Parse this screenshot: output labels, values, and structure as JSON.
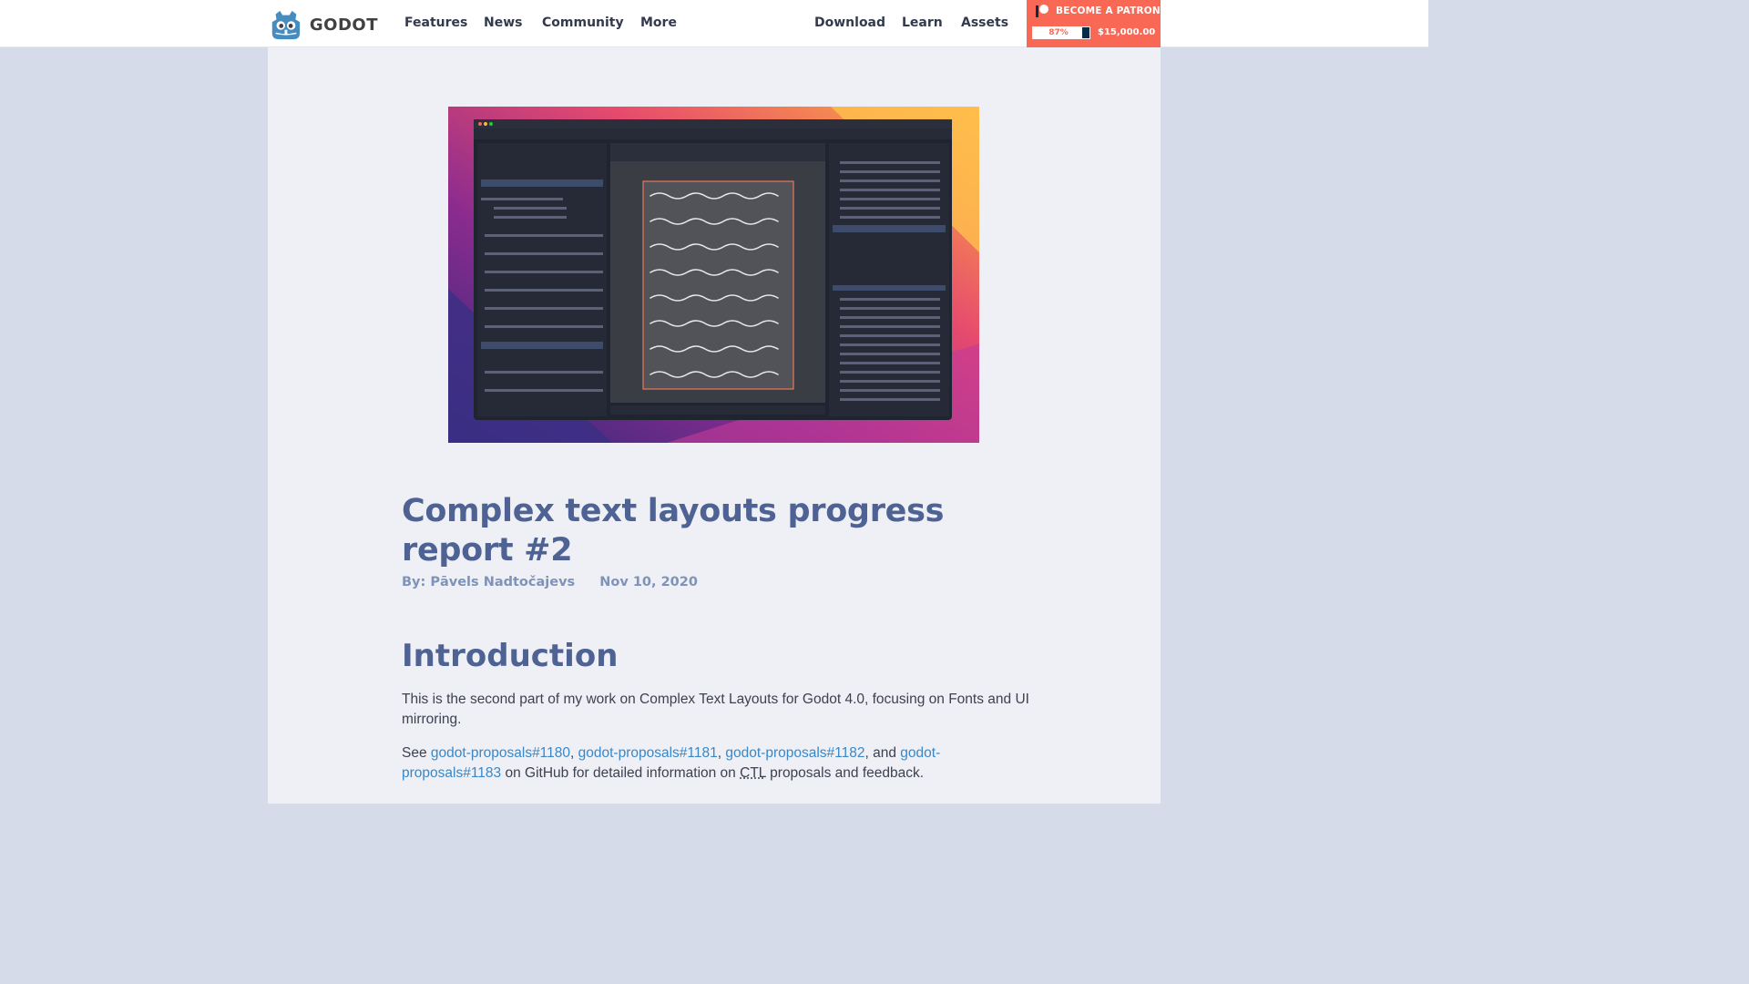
{
  "header": {
    "logo_text": "GODOT",
    "nav_left": [
      "Features",
      "News",
      "Community",
      "More"
    ],
    "nav_right": [
      "Download",
      "Learn",
      "Assets"
    ],
    "patron": {
      "label": "BECOME A PATRON",
      "progress_percent": 87,
      "progress_label": "87%",
      "goal": "$15,000.00"
    }
  },
  "article": {
    "title": "Complex text layouts progress report #2",
    "author": "By: Pāvels Nadtočajevs",
    "date": "Nov 10, 2020",
    "section_heading": "Introduction",
    "intro_paragraph": "This is the second part of my work on Complex Text Layouts for Godot 4.0, focusing on Fonts and UI mirroring.",
    "see_prefix": "See",
    "links": [
      "godot-proposals#1180",
      "godot-proposals#1181",
      "godot-proposals#1182",
      "godot-proposals#1183"
    ],
    "sep_comma": ",",
    "sep_and": ", and",
    "see_suffix": "on GitHub for detailed information on",
    "abbr_ctl": "CTL",
    "see_end": "proposals and feedback."
  },
  "colors": {
    "accent": "#4e6293",
    "link": "#3a87c7",
    "patron": "#f96854",
    "background": "#d6dbe9"
  }
}
